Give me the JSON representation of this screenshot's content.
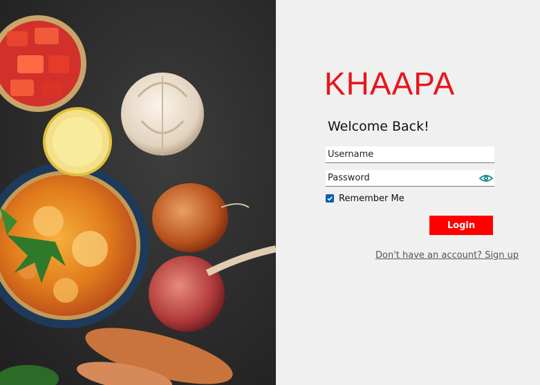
{
  "brand": {
    "name": "KHAAPA",
    "color": "#e8151b"
  },
  "form": {
    "heading": "Welcome Back!",
    "username_placeholder": "Username",
    "password_placeholder": "Password",
    "remember_label": "Remember Me",
    "remember_checked": true,
    "login_label": "Login",
    "signup_link": "Don't have an account? Sign up"
  },
  "colors": {
    "accent": "#ff0000",
    "checkbox": "#0b5cad",
    "eye_icon": "#1a8a8a"
  },
  "icons": {
    "password_toggle": "eye-icon",
    "checkbox_mark": "checkmark-icon"
  }
}
